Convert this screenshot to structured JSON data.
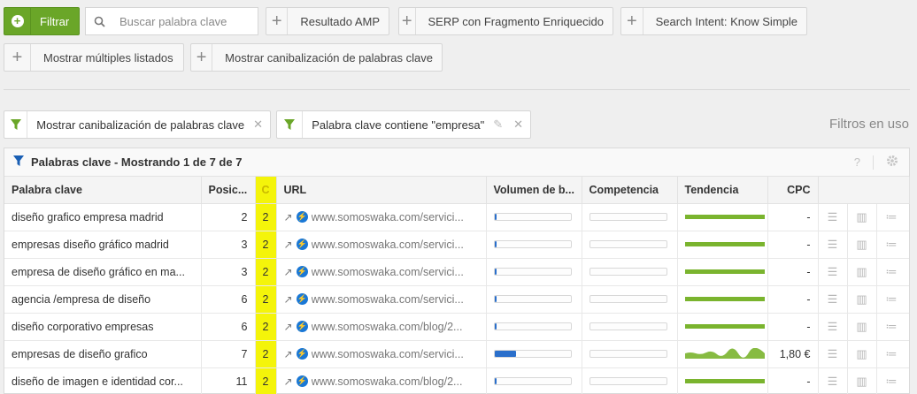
{
  "toolbar": {
    "filter_label": "Filtrar",
    "search_placeholder": "Buscar palabra clave",
    "buttons": [
      "Resultado AMP",
      "SERP con Fragmento Enriquecido",
      "Search Intent: Know Simple",
      "Mostrar múltiples listados",
      "Mostrar canibalización de palabras clave"
    ]
  },
  "chips": [
    {
      "label": "Mostrar canibalización de palabras clave"
    },
    {
      "label": "Palabra clave contiene \"empresa\""
    }
  ],
  "filters_used": "Filtros en uso",
  "panel": {
    "title": "Palabras clave - Mostrando 1 de 7 de 7",
    "help": "?"
  },
  "columns": [
    "Palabra clave",
    "Posic...",
    "C",
    "URL",
    "Volumen de b...",
    "Competencia",
    "Tendencia",
    "CPC"
  ],
  "rows": [
    {
      "keyword": "diseño grafico empresa madrid",
      "pos": "2",
      "c": "2",
      "url": "www.somoswaka.com/servici...",
      "volume": 0.03,
      "cpc": "-",
      "trend": "flat"
    },
    {
      "keyword": "empresas diseño gráfico madrid",
      "pos": "3",
      "c": "2",
      "url": "www.somoswaka.com/servici...",
      "volume": 0.03,
      "cpc": "-",
      "trend": "flat"
    },
    {
      "keyword": "empresa de diseño gráfico en ma...",
      "pos": "3",
      "c": "2",
      "url": "www.somoswaka.com/servici...",
      "volume": 0.03,
      "cpc": "-",
      "trend": "flat"
    },
    {
      "keyword": "agencia /empresa de diseño",
      "pos": "6",
      "c": "2",
      "url": "www.somoswaka.com/servici...",
      "volume": 0.03,
      "cpc": "-",
      "trend": "flat"
    },
    {
      "keyword": "diseño corporativo empresas",
      "pos": "6",
      "c": "2",
      "url": "www.somoswaka.com/blog/2...",
      "volume": 0.03,
      "cpc": "-",
      "trend": "flat"
    },
    {
      "keyword": "empresas de diseño grafico",
      "pos": "7",
      "c": "2",
      "url": "www.somoswaka.com/servici...",
      "volume": 0.28,
      "cpc": "1,80 €",
      "trend": "wave"
    },
    {
      "keyword": "diseño de imagen e identidad cor...",
      "pos": "11",
      "c": "2",
      "url": "www.somoswaka.com/blog/2...",
      "volume": 0.03,
      "cpc": "-",
      "trend": "flat"
    }
  ],
  "colors": {
    "accent": "#6aa628",
    "highlight": "#f4f40a",
    "bar": "#2a6fcb",
    "trend": "#7ab42e"
  }
}
